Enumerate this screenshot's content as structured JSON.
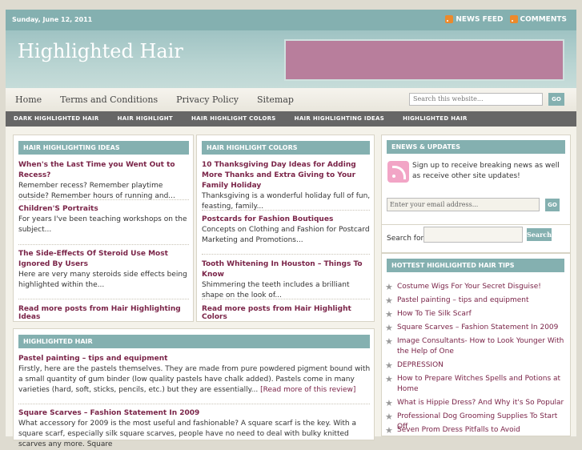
{
  "topbar": {
    "date": "Sunday, June 12, 2011",
    "news_feed": "NEWS FEED",
    "comments": "COMMENTS"
  },
  "header": {
    "site_title": "Highlighted Hair"
  },
  "nav": {
    "items": [
      "Home",
      "Terms and Conditions",
      "Privacy Policy",
      "Sitemap"
    ],
    "search_placeholder": "Search this website...",
    "search_go": "GO"
  },
  "subnav": {
    "items": [
      "DARK HIGHLIGHTED HAIR",
      "HAIR HIGHLIGHT",
      "HAIR HIGHLIGHT COLORS",
      "HAIR HIGHLIGHTING IDEAS",
      "HIGHLIGHTED HAIR"
    ]
  },
  "box1": {
    "title": "HAIR HIGHLIGHTING IDEAS",
    "posts": [
      {
        "title": "When's the Last Time you Went Out to Recess?",
        "excerpt": "Remember recess? Remember playtime outside? Remember hours of running and..."
      },
      {
        "title": "Children'S Portraits",
        "excerpt": "For years I've been teaching workshops on the subject..."
      },
      {
        "title": "The Side-Effects Of Steroid Use Most Ignored By Users",
        "excerpt": "Here are very many steroids side effects being highlighted within the..."
      }
    ],
    "more": "Read more posts from Hair Highlighting Ideas"
  },
  "box2": {
    "title": "HAIR HIGHLIGHT COLORS",
    "posts": [
      {
        "title": "10 Thanksgiving Day Ideas for Adding More Thanks and Extra Giving to Your Family Holiday",
        "excerpt": "Thanksgiving is a wonderful holiday full of fun, feasting, family..."
      },
      {
        "title": "Postcards for Fashion Boutiques",
        "excerpt": "Concepts on Clothing and Fashion for Postcard Marketing and Promotions..."
      },
      {
        "title": "Tooth Whitening In Houston – Things To Know",
        "excerpt": "Shimmering the teeth includes a brilliant shape on the look of..."
      }
    ],
    "more": "Read more posts from Hair Highlight Colors"
  },
  "box3": {
    "title": "HIGHLIGHTED HAIR",
    "posts": [
      {
        "title": "Pastel painting – tips and equipment",
        "excerpt": "Firstly, here are the pastels themselves. They are made from pure powdered pigment bound with a small quantity of gum binder (low quality pastels have chalk added). Pastels come in many varieties (hard, soft, sticks, pencils, etc.) but they are essentially...",
        "more": "[Read more of this review]"
      },
      {
        "title": "Square Scarves – Fashion Statement In 2009",
        "excerpt": "What accessory for 2009 is the most useful and fashionable? A square scarf is the key. With a square scarf, especially silk square scarves, people have no need to deal with bulky knitted scarves any more. Square"
      }
    ]
  },
  "enews": {
    "title": "ENEWS & UPDATES",
    "text": "Sign up to receive breaking news as well as receive other site updates!",
    "placeholder": "Enter your email address...",
    "go": "GO"
  },
  "sidebar_search": {
    "label": "Search for:",
    "button": "Search"
  },
  "tips": {
    "title": "HOTTEST HIGHLIGHTED HAIR TIPS",
    "items": [
      "Costume Wigs For Your Secret Disguise!",
      "Pastel painting – tips and equipment",
      "How To Tie Silk Scarf",
      "Square Scarves – Fashion Statement In 2009",
      "Image Consultants- How to Look Younger With the Help of One",
      "DEPRESSION",
      "How to Prepare Witches Spells and Potions at Home",
      "What is Hippie Dress? And Why it's So Popular",
      "Professional Dog Grooming Supplies To Start Off",
      "Seven Prom Dress Pitfalls to Avoid"
    ]
  },
  "colors": {
    "accent": "#84b0b0",
    "link": "#7a2448",
    "banner": "#b87e9c"
  }
}
